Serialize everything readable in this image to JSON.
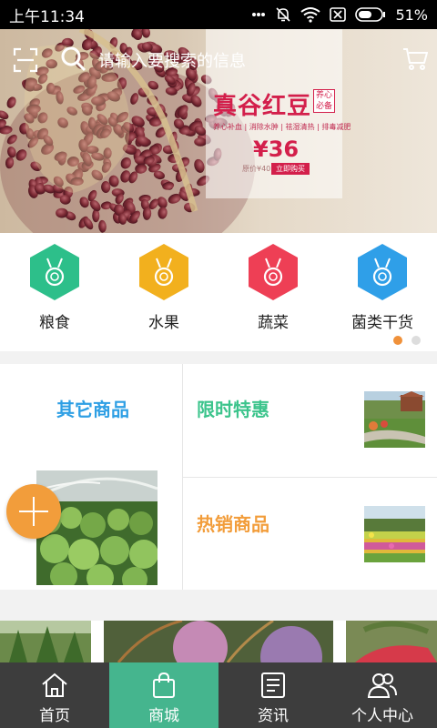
{
  "status_bar": {
    "time": "上午11:34",
    "battery": "51%"
  },
  "search": {
    "placeholder": "请输入要搜索的信息"
  },
  "banner": {
    "title": "真谷红豆",
    "badge": "养心必备",
    "tags": "养心补血 | 消除水肿 | 祛湿清热 | 排毒减肥",
    "price": "¥36",
    "original_price": "原价¥40",
    "buy_label": "立即购买"
  },
  "categories": [
    {
      "label": "粮食",
      "color": "#2dbf8a",
      "icon": "medal-icon"
    },
    {
      "label": "水果",
      "color": "#f2b01e",
      "icon": "medal-icon"
    },
    {
      "label": "蔬菜",
      "color": "#ee3f55",
      "icon": "medal-icon"
    },
    {
      "label": "菌类干货",
      "color": "#2f9fe8",
      "icon": "medal-icon"
    }
  ],
  "sections": {
    "other": "其它商品",
    "flash_sale": "限时特惠",
    "hot": "热销商品"
  },
  "tabs": [
    {
      "label": "首页",
      "icon": "home-icon",
      "active": false
    },
    {
      "label": "商城",
      "icon": "shopping-bag-icon",
      "active": true
    },
    {
      "label": "资讯",
      "icon": "news-icon",
      "active": false
    },
    {
      "label": "个人中心",
      "icon": "user-center-icon",
      "active": false
    }
  ],
  "colors": {
    "active_tab": "#45b58e",
    "tabbar": "#3d3d3d",
    "accent_orange": "#f29d3b",
    "blue_title": "#2e9fe4",
    "green_title": "#3cc48c"
  }
}
